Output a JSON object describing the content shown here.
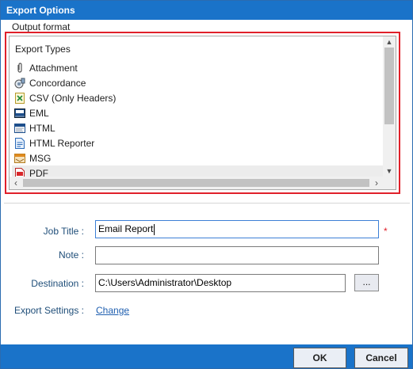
{
  "window": {
    "title": "Export Options"
  },
  "output_format": {
    "group_label": "Output format",
    "list_header": "Export Types",
    "items": [
      {
        "label": "Attachment",
        "icon": "paperclip-icon"
      },
      {
        "label": "Concordance",
        "icon": "concordance-icon"
      },
      {
        "label": "CSV (Only Headers)",
        "icon": "csv-icon"
      },
      {
        "label": "EML",
        "icon": "eml-icon"
      },
      {
        "label": "HTML",
        "icon": "html-icon"
      },
      {
        "label": "HTML Reporter",
        "icon": "html-reporter-icon"
      },
      {
        "label": "MSG",
        "icon": "msg-icon"
      },
      {
        "label": "PDF",
        "icon": "pdf-icon",
        "selected": true
      }
    ]
  },
  "form": {
    "job_title_label": "Job Title :",
    "job_title_value": "Email Report",
    "required_marker": "*",
    "note_label": "Note :",
    "note_value": "",
    "destination_label": "Destination :",
    "destination_value": "C:\\Users\\Administrator\\Desktop",
    "browse_label": "...",
    "export_settings_label": "Export Settings :",
    "change_link": "Change"
  },
  "footer": {
    "ok_label": "OK",
    "cancel_label": "Cancel"
  },
  "colors": {
    "title_bar": "#1a73c9",
    "highlight_border": "#e0202a",
    "link": "#1f5fb0"
  }
}
